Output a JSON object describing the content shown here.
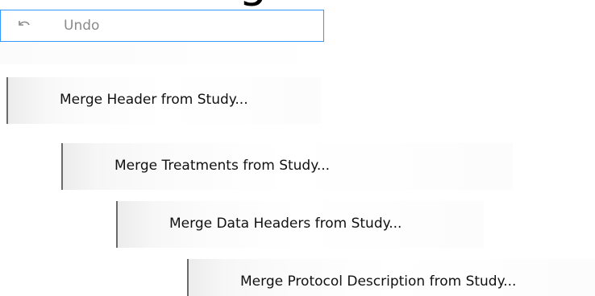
{
  "top_artifact_text": "g",
  "undo": {
    "label": "Undo",
    "icon": "undo-icon"
  },
  "menu_items": [
    {
      "label": "Merge Header from Study..."
    },
    {
      "label": "Merge Treatments from Study..."
    },
    {
      "label": "Merge Data Headers from Study..."
    },
    {
      "label": "Merge Protocol Description from Study..."
    }
  ],
  "colors": {
    "selection_border": "#3399ff",
    "disabled_text": "#8a8a8a",
    "separator": "#6a6a6a"
  }
}
